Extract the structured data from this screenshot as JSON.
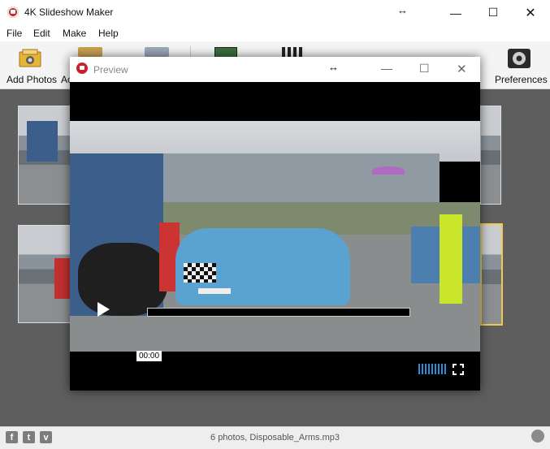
{
  "window": {
    "title": "4K Slideshow Maker"
  },
  "menu": [
    "File",
    "Edit",
    "Make",
    "Help"
  ],
  "toolbar": {
    "add_photos": "Add Photos",
    "add_truncated": "Ac",
    "preferences": "Preferences"
  },
  "preview": {
    "title": "Preview",
    "time": "00:00",
    "progress": 0
  },
  "status": {
    "text": "6 photos, Disposable_Arms.mp3",
    "social": [
      "f",
      "t",
      "v"
    ]
  },
  "colors": {
    "accent": "#2b8fd6",
    "selection": "#f2c94c",
    "app_red": "#c8202f"
  }
}
